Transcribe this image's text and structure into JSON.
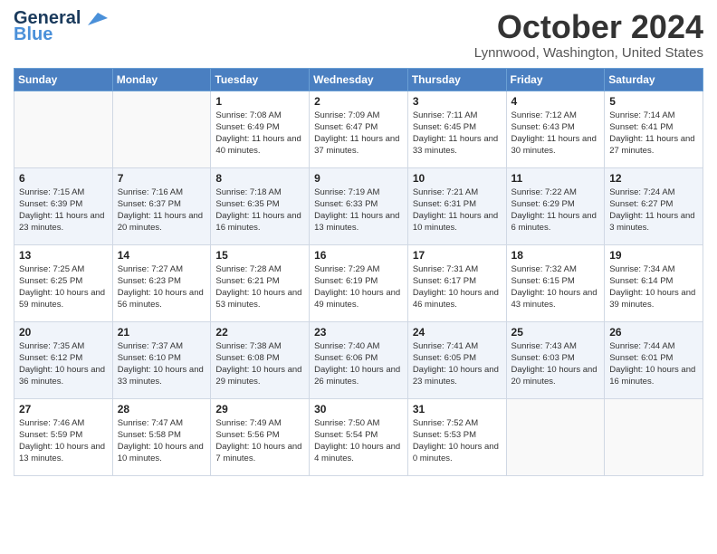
{
  "header": {
    "logo_line1": "General",
    "logo_line2": "Blue",
    "month_title": "October 2024",
    "location": "Lynnwood, Washington, United States"
  },
  "days_of_week": [
    "Sunday",
    "Monday",
    "Tuesday",
    "Wednesday",
    "Thursday",
    "Friday",
    "Saturday"
  ],
  "weeks": [
    [
      {
        "day": "",
        "info": ""
      },
      {
        "day": "",
        "info": ""
      },
      {
        "day": "1",
        "info": "Sunrise: 7:08 AM\nSunset: 6:49 PM\nDaylight: 11 hours and 40 minutes."
      },
      {
        "day": "2",
        "info": "Sunrise: 7:09 AM\nSunset: 6:47 PM\nDaylight: 11 hours and 37 minutes."
      },
      {
        "day": "3",
        "info": "Sunrise: 7:11 AM\nSunset: 6:45 PM\nDaylight: 11 hours and 33 minutes."
      },
      {
        "day": "4",
        "info": "Sunrise: 7:12 AM\nSunset: 6:43 PM\nDaylight: 11 hours and 30 minutes."
      },
      {
        "day": "5",
        "info": "Sunrise: 7:14 AM\nSunset: 6:41 PM\nDaylight: 11 hours and 27 minutes."
      }
    ],
    [
      {
        "day": "6",
        "info": "Sunrise: 7:15 AM\nSunset: 6:39 PM\nDaylight: 11 hours and 23 minutes."
      },
      {
        "day": "7",
        "info": "Sunrise: 7:16 AM\nSunset: 6:37 PM\nDaylight: 11 hours and 20 minutes."
      },
      {
        "day": "8",
        "info": "Sunrise: 7:18 AM\nSunset: 6:35 PM\nDaylight: 11 hours and 16 minutes."
      },
      {
        "day": "9",
        "info": "Sunrise: 7:19 AM\nSunset: 6:33 PM\nDaylight: 11 hours and 13 minutes."
      },
      {
        "day": "10",
        "info": "Sunrise: 7:21 AM\nSunset: 6:31 PM\nDaylight: 11 hours and 10 minutes."
      },
      {
        "day": "11",
        "info": "Sunrise: 7:22 AM\nSunset: 6:29 PM\nDaylight: 11 hours and 6 minutes."
      },
      {
        "day": "12",
        "info": "Sunrise: 7:24 AM\nSunset: 6:27 PM\nDaylight: 11 hours and 3 minutes."
      }
    ],
    [
      {
        "day": "13",
        "info": "Sunrise: 7:25 AM\nSunset: 6:25 PM\nDaylight: 10 hours and 59 minutes."
      },
      {
        "day": "14",
        "info": "Sunrise: 7:27 AM\nSunset: 6:23 PM\nDaylight: 10 hours and 56 minutes."
      },
      {
        "day": "15",
        "info": "Sunrise: 7:28 AM\nSunset: 6:21 PM\nDaylight: 10 hours and 53 minutes."
      },
      {
        "day": "16",
        "info": "Sunrise: 7:29 AM\nSunset: 6:19 PM\nDaylight: 10 hours and 49 minutes."
      },
      {
        "day": "17",
        "info": "Sunrise: 7:31 AM\nSunset: 6:17 PM\nDaylight: 10 hours and 46 minutes."
      },
      {
        "day": "18",
        "info": "Sunrise: 7:32 AM\nSunset: 6:15 PM\nDaylight: 10 hours and 43 minutes."
      },
      {
        "day": "19",
        "info": "Sunrise: 7:34 AM\nSunset: 6:14 PM\nDaylight: 10 hours and 39 minutes."
      }
    ],
    [
      {
        "day": "20",
        "info": "Sunrise: 7:35 AM\nSunset: 6:12 PM\nDaylight: 10 hours and 36 minutes."
      },
      {
        "day": "21",
        "info": "Sunrise: 7:37 AM\nSunset: 6:10 PM\nDaylight: 10 hours and 33 minutes."
      },
      {
        "day": "22",
        "info": "Sunrise: 7:38 AM\nSunset: 6:08 PM\nDaylight: 10 hours and 29 minutes."
      },
      {
        "day": "23",
        "info": "Sunrise: 7:40 AM\nSunset: 6:06 PM\nDaylight: 10 hours and 26 minutes."
      },
      {
        "day": "24",
        "info": "Sunrise: 7:41 AM\nSunset: 6:05 PM\nDaylight: 10 hours and 23 minutes."
      },
      {
        "day": "25",
        "info": "Sunrise: 7:43 AM\nSunset: 6:03 PM\nDaylight: 10 hours and 20 minutes."
      },
      {
        "day": "26",
        "info": "Sunrise: 7:44 AM\nSunset: 6:01 PM\nDaylight: 10 hours and 16 minutes."
      }
    ],
    [
      {
        "day": "27",
        "info": "Sunrise: 7:46 AM\nSunset: 5:59 PM\nDaylight: 10 hours and 13 minutes."
      },
      {
        "day": "28",
        "info": "Sunrise: 7:47 AM\nSunset: 5:58 PM\nDaylight: 10 hours and 10 minutes."
      },
      {
        "day": "29",
        "info": "Sunrise: 7:49 AM\nSunset: 5:56 PM\nDaylight: 10 hours and 7 minutes."
      },
      {
        "day": "30",
        "info": "Sunrise: 7:50 AM\nSunset: 5:54 PM\nDaylight: 10 hours and 4 minutes."
      },
      {
        "day": "31",
        "info": "Sunrise: 7:52 AM\nSunset: 5:53 PM\nDaylight: 10 hours and 0 minutes."
      },
      {
        "day": "",
        "info": ""
      },
      {
        "day": "",
        "info": ""
      }
    ]
  ]
}
